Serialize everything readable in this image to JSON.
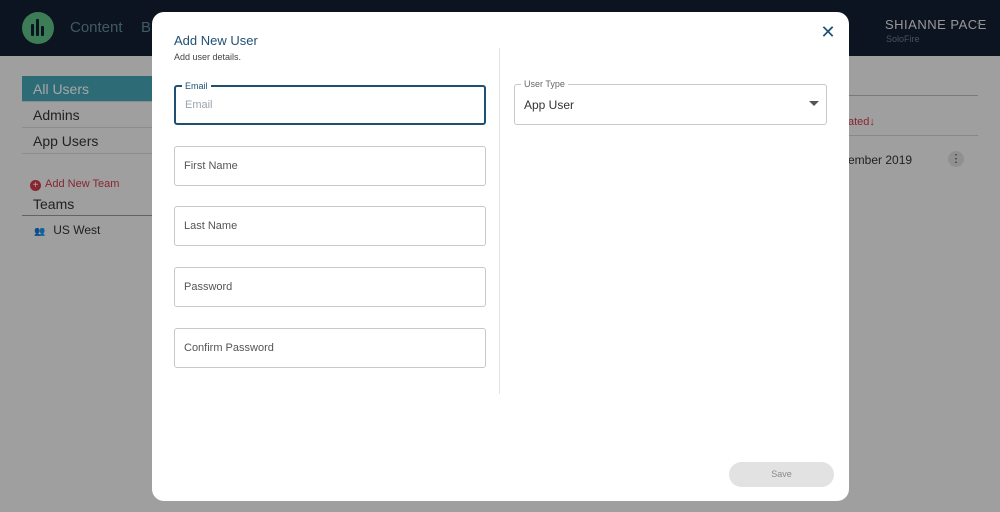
{
  "topbar": {
    "nav": [
      "Content",
      "Br"
    ],
    "user": {
      "name": "SHIANNE PACE",
      "org": "SoloFire"
    }
  },
  "sidebar": {
    "items": [
      {
        "label": "All Users",
        "active": true
      },
      {
        "label": "Admins"
      },
      {
        "label": "App Users"
      }
    ],
    "add_team_label": "Add New Team",
    "teams_heading": "Teams",
    "teams": [
      {
        "label": "US West"
      }
    ]
  },
  "list": {
    "sort_header": "ated",
    "sort_icon": "arrow-down-icon",
    "rows": [
      {
        "date": "ember 2019"
      }
    ]
  },
  "modal": {
    "title": "Add New User",
    "subtitle": "Add user details.",
    "fields": {
      "email": {
        "label": "Email",
        "placeholder": "Email",
        "value": ""
      },
      "first_name": {
        "placeholder": "First Name",
        "value": ""
      },
      "last_name": {
        "placeholder": "Last Name",
        "value": ""
      },
      "password": {
        "placeholder": "Password",
        "value": ""
      },
      "confirm_password": {
        "placeholder": "Confirm Password",
        "value": ""
      }
    },
    "user_type": {
      "label": "User Type",
      "value": "App User"
    },
    "save_label": "Save"
  },
  "colors": {
    "topbar": "#142033",
    "accent": "#46a7b5",
    "primary_text": "#1f5073",
    "danger": "#d23b4b",
    "logo": "#5cbf86"
  }
}
